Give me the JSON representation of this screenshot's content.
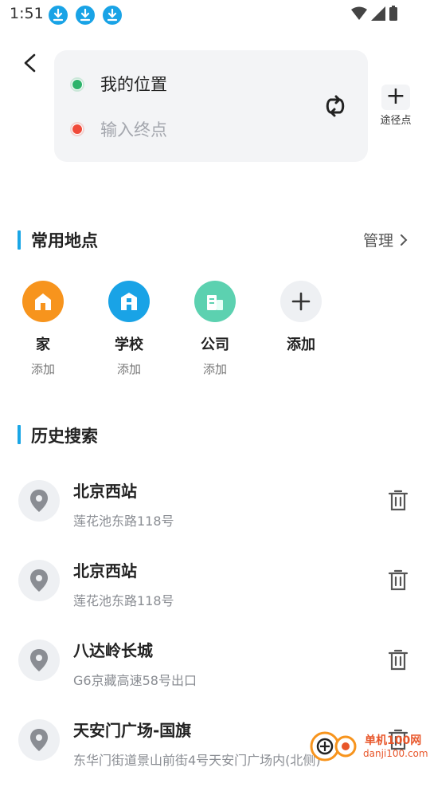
{
  "status_bar": {
    "time": "1:51",
    "download_icons": 3
  },
  "route": {
    "start_label": "我的位置",
    "end_placeholder": "输入终点",
    "waypoint_label": "途径点"
  },
  "common_places": {
    "title": "常用地点",
    "manage_label": "管理",
    "items": [
      {
        "name": "家",
        "sub": "添加",
        "icon": "home-icon",
        "color": "#f7941d"
      },
      {
        "name": "学校",
        "sub": "添加",
        "icon": "school-icon",
        "color": "#19a3e6"
      },
      {
        "name": "公司",
        "sub": "添加",
        "icon": "company-icon",
        "color": "#5cd1b0"
      },
      {
        "name": "添加",
        "icon": "plus-icon",
        "color": "#eef0f3"
      }
    ]
  },
  "history": {
    "title": "历史搜索",
    "items": [
      {
        "title": "北京西站",
        "address": "莲花池东路118号"
      },
      {
        "title": "北京西站",
        "address": "莲花池东路118号"
      },
      {
        "title": "八达岭长城",
        "address": "G6京藏高速58号出口"
      },
      {
        "title": "天安门广场-国旗",
        "address": "东华门街道景山前街4号天安门广场内(北侧)"
      }
    ]
  },
  "watermark": {
    "brand": "单机100网",
    "url": "danji100.com"
  }
}
